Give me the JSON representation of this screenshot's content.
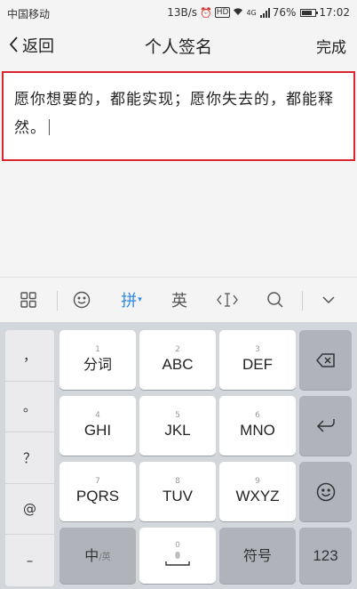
{
  "status_bar": {
    "carrier": "中国移动",
    "speed": "13B/s",
    "network": "4G",
    "battery": "76%",
    "battery_level": 0.76,
    "time": "17:02",
    "icons": [
      "alarm-icon",
      "hd-icon",
      "wifi-icon",
      "signal-icon",
      "battery-icon"
    ]
  },
  "nav": {
    "back_label": "返回",
    "title": "个人签名",
    "done_label": "完成"
  },
  "editor": {
    "value": "愿你想要的，都能实现；愿你失去的，都能释然。"
  },
  "keyboard": {
    "toolbar": {
      "layout_icon": "grid-icon",
      "emoji_icon": "smiley-icon",
      "pinyin_label": "拼",
      "english_label": "英",
      "cursor_icon": "cursor-move-icon",
      "search_icon": "search-icon",
      "collapse_icon": "chevron-down-icon"
    },
    "punctuation": [
      "，",
      "。",
      "？",
      "@",
      "–"
    ],
    "keys": [
      {
        "num": "1",
        "label": "分词"
      },
      {
        "num": "2",
        "label": "ABC"
      },
      {
        "num": "3",
        "label": "DEF"
      },
      {
        "num": "4",
        "label": "GHI"
      },
      {
        "num": "5",
        "label": "JKL"
      },
      {
        "num": "6",
        "label": "MNO"
      },
      {
        "num": "7",
        "label": "PQRS"
      },
      {
        "num": "8",
        "label": "TUV"
      },
      {
        "num": "9",
        "label": "WXYZ"
      }
    ],
    "bottom": {
      "lang_main": "中",
      "lang_sub": "/英",
      "space_num": "0",
      "symbol_label": "符号",
      "numeric_label": "123"
    },
    "side_icons": [
      "backspace-icon",
      "enter-icon",
      "emoji-icon"
    ]
  }
}
